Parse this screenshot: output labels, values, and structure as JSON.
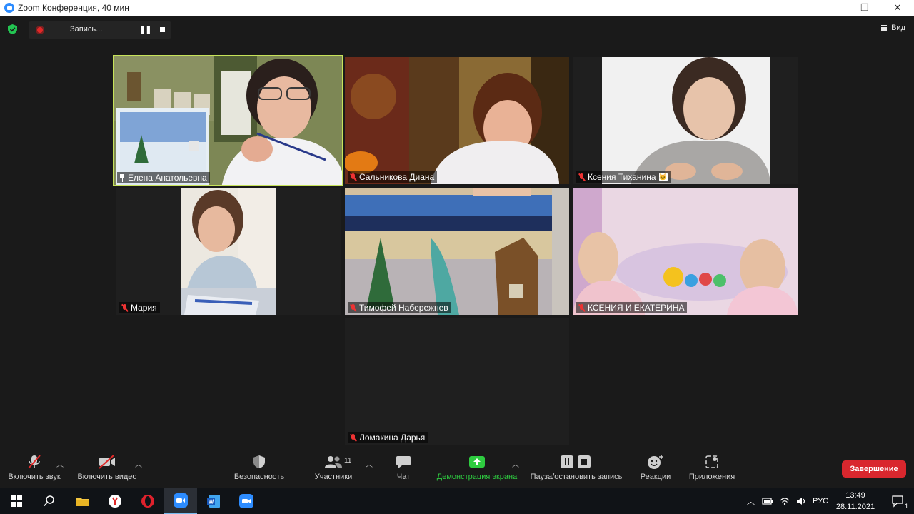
{
  "window": {
    "title": "Zoom Конференция, 40 мин",
    "controls": [
      "—",
      "❐",
      "✕"
    ]
  },
  "topbar": {
    "recording_label": "Запись...",
    "view_label": "Вид"
  },
  "participants": [
    {
      "name": "Елена Анатольевна",
      "status": "pinned",
      "active_speaker": true
    },
    {
      "name": "Сальникова Диана",
      "status": "muted"
    },
    {
      "name": "Ксения Тиханина",
      "status": "muted",
      "badge": "🐱"
    },
    {
      "name": "Мария",
      "status": "muted"
    },
    {
      "name": "Тимофей Набережнев",
      "status": "muted"
    },
    {
      "name": "КСЕНИЯ И  ЕКАТЕРИНА",
      "status": "muted"
    },
    {
      "name": "Ломакина Дарья",
      "status": "muted"
    }
  ],
  "toolbar": {
    "unmute": "Включить звук",
    "start_video": "Включить видео",
    "security": "Безопасность",
    "participants": "Участники",
    "participants_count": "11",
    "chat": "Чат",
    "share_screen": "Демонстрация экрана",
    "pause_stop_recording": "Пауза/остановить запись",
    "reactions": "Реакции",
    "apps": "Приложения",
    "end": "Завершение"
  },
  "taskbar": {
    "language": "РУС",
    "time": "13:49",
    "date": "28.11.2021",
    "notifications_count": "1"
  },
  "colors": {
    "active_speaker_border": "#c7e35a",
    "end_button": "#d9272e",
    "share_green": "#2ecc40",
    "zoom_blue": "#2d8cff"
  }
}
